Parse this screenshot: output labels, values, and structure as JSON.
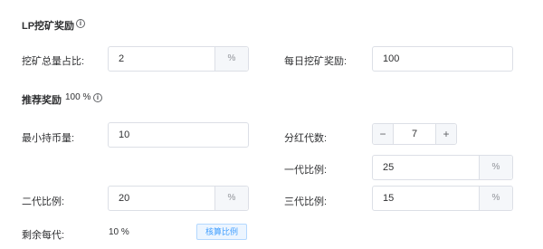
{
  "lp_section": {
    "title": "LP挖矿奖励",
    "info_icon": "info-circle-icon"
  },
  "mining_ratio": {
    "label": "挖矿总量占比:",
    "value": "2",
    "unit": "%"
  },
  "daily_reward": {
    "label": "每日挖矿奖励:",
    "value": "100"
  },
  "referral_section": {
    "title": "推荐奖励",
    "percent": "100 %",
    "info_icon": "info-circle-icon"
  },
  "min_holding": {
    "label": "最小持币量:",
    "value": "10"
  },
  "generations": {
    "label": "分红代数:",
    "value": "7",
    "minus": "−",
    "plus": "+"
  },
  "gen1_ratio": {
    "label": "一代比例:",
    "value": "25",
    "unit": "%"
  },
  "gen2_ratio": {
    "label": "二代比例:",
    "value": "20",
    "unit": "%"
  },
  "gen3_ratio": {
    "label": "三代比例:",
    "value": "15",
    "unit": "%"
  },
  "remaining": {
    "label": "剩余每代:",
    "value": "10 %",
    "check_button": "核算比例"
  },
  "colors": {
    "primary": "#409eff",
    "border": "#dcdfe6",
    "append_bg": "#f5f7fa"
  }
}
